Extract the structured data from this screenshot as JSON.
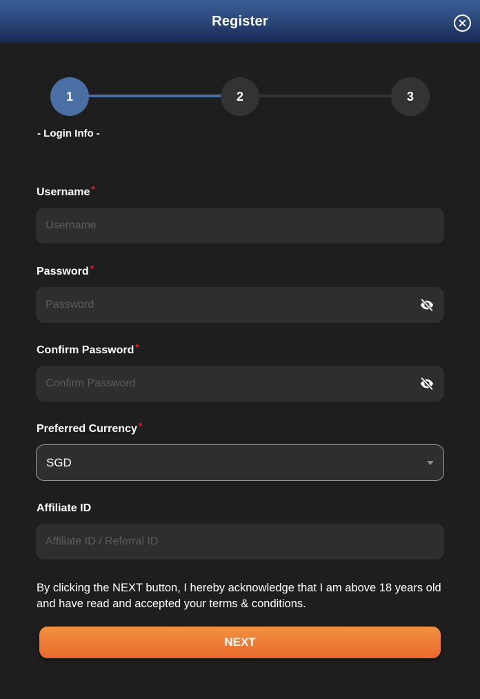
{
  "header": {
    "title": "Register",
    "close_icon": "close-circle-icon"
  },
  "stepper": {
    "steps": [
      {
        "number": "1",
        "state": "active"
      },
      {
        "number": "2",
        "state": "inactive"
      },
      {
        "number": "3",
        "state": "inactive"
      }
    ],
    "current_step_label": "- Login Info -",
    "colors": {
      "active": "#4a6fa5",
      "inactive": "#333333"
    }
  },
  "form": {
    "required_marker": "*",
    "username": {
      "label": "Username",
      "placeholder": "Username",
      "value": "",
      "required": true
    },
    "password": {
      "label": "Password",
      "placeholder": "Password",
      "value": "",
      "required": true,
      "icon": "eye-slash-icon"
    },
    "confirm_password": {
      "label": "Confirm Password",
      "placeholder": "Confirm Password",
      "value": "",
      "required": true,
      "icon": "eye-slash-icon"
    },
    "currency": {
      "label": "Preferred Currency",
      "selected": "SGD",
      "required": true
    },
    "affiliate": {
      "label": "Affiliate ID",
      "placeholder": "Affiliate ID / Referral ID",
      "value": "",
      "required": false
    }
  },
  "disclaimer": "By clicking the NEXT button, I hereby acknowledge that I am above 18 years old and have read and accepted your terms & conditions.",
  "next_button": {
    "label": "NEXT",
    "color": "#ec7a33"
  }
}
